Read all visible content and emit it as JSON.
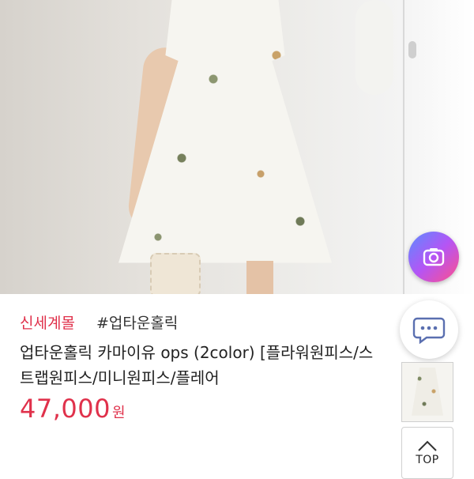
{
  "product": {
    "store_name": "신세계몰",
    "hashtag": "#업타운홀릭",
    "title_line1": "업타운홀릭 카마이유 ops (2color) [플라워원피스/스",
    "title_line2": "트랩원피스/미니원피스/플레어",
    "price_value": "47,000",
    "price_unit": "원"
  },
  "floating": {
    "top_label": "TOP"
  },
  "colors": {
    "accent_red": "#e0314b",
    "text_dark": "#222222"
  },
  "icons": [
    "camera-icon",
    "chat-bubble-icon",
    "chevron-up-icon"
  ]
}
